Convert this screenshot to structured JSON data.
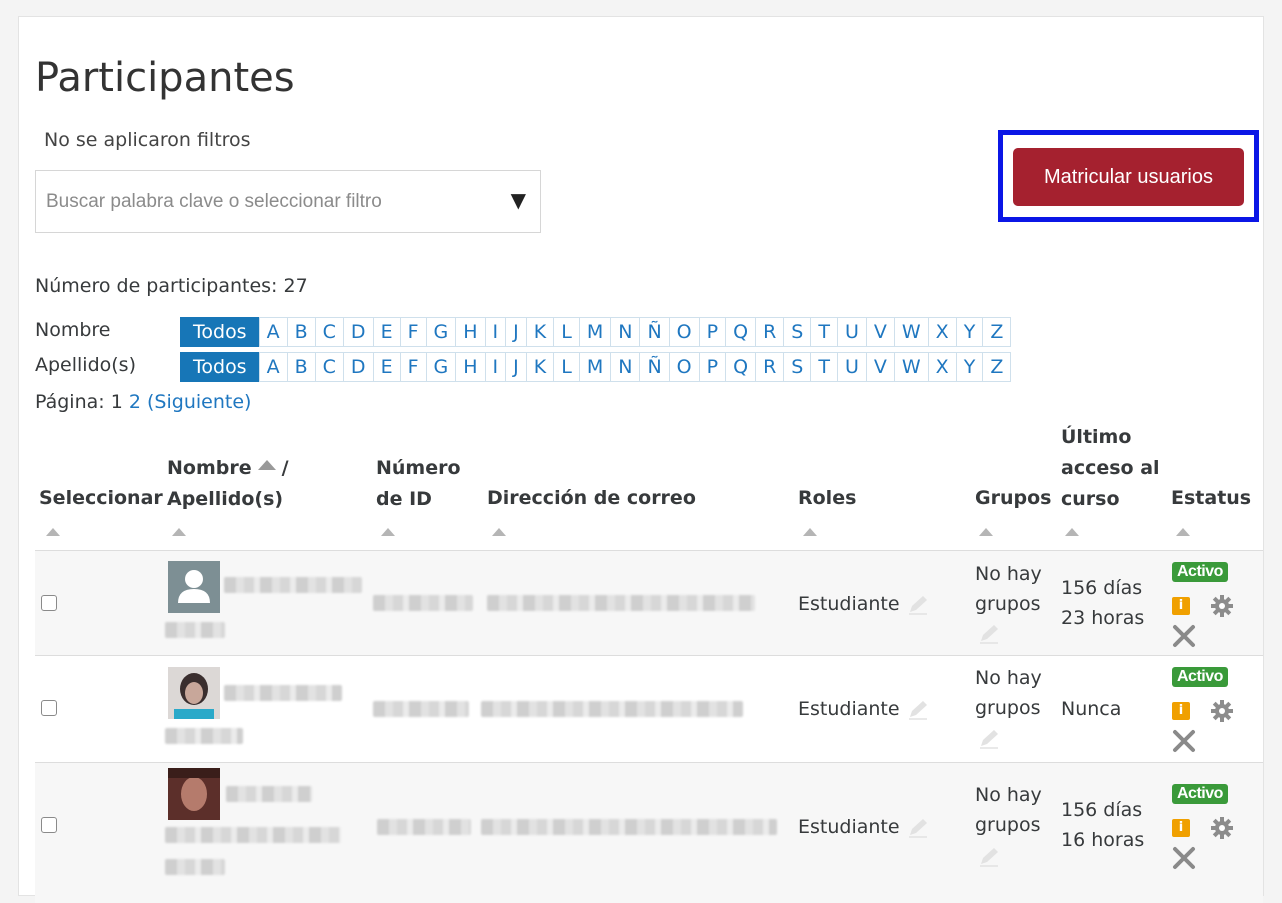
{
  "page": {
    "title": "Participantes"
  },
  "filters": {
    "status": "No se aplicaron filtros",
    "search_placeholder": "Buscar palabra clave o seleccionar filtro"
  },
  "actions": {
    "enrol_label": "Matricular usuarios"
  },
  "summary": {
    "count_label": "Número de participantes: 27"
  },
  "initials": {
    "first_label": "Nombre",
    "last_label": "Apellido(s)",
    "all_label": "Todos",
    "letters": [
      "A",
      "B",
      "C",
      "D",
      "E",
      "F",
      "G",
      "H",
      "I",
      "J",
      "K",
      "L",
      "M",
      "N",
      "Ñ",
      "O",
      "P",
      "Q",
      "R",
      "S",
      "T",
      "U",
      "V",
      "W",
      "X",
      "Y",
      "Z"
    ]
  },
  "paging": {
    "label": "Página:",
    "p1": "1",
    "p2": "2",
    "next": "(Siguiente)"
  },
  "table": {
    "headers": {
      "select": "Seleccionar",
      "name_first": "Nombre",
      "name_sep": "/",
      "name_last": "Apellido(s)",
      "id_line1": "Número",
      "id_line2": "de ID",
      "email": "Dirección de correo",
      "roles": "Roles",
      "groups": "Grupos",
      "access_line1": "Último",
      "access_line2": "acceso al",
      "access_line3": "curso",
      "status": "Estatus"
    },
    "rows": [
      {
        "role": "Estudiante",
        "groups_l1": "No hay",
        "groups_l2": "grupos",
        "access_l1": "156 días",
        "access_l2": "23 horas",
        "status": "Activo"
      },
      {
        "role": "Estudiante",
        "groups_l1": "No hay",
        "groups_l2": "grupos",
        "access_l1": "Nunca",
        "access_l2": "",
        "status": "Activo"
      },
      {
        "role": "Estudiante",
        "groups_l1": "No hay",
        "groups_l2": "grupos",
        "access_l1": "156 días",
        "access_l2": "16 horas",
        "status": "Activo"
      }
    ],
    "info_glyph": "i"
  },
  "icons": [
    "chevron-down-icon",
    "sort-asc-icon",
    "sort-icon",
    "user-placeholder-icon",
    "pencil-icon",
    "info-icon",
    "gear-icon",
    "close-icon"
  ],
  "colors": {
    "primary_button": "#a5212f",
    "highlight_frame": "#0b16e6",
    "active_letter": "#1776b7",
    "status_active": "#3a9a3a",
    "info": "#f0a000"
  }
}
